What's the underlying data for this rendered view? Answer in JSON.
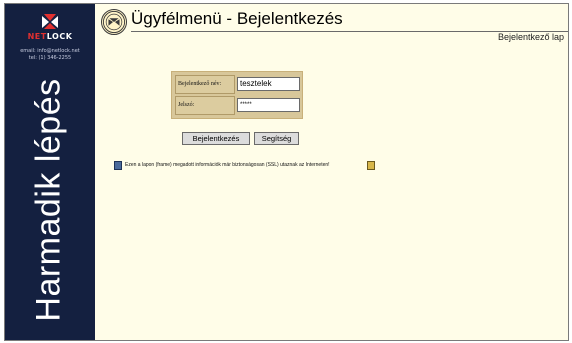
{
  "sidebar": {
    "logo": "NETLOCK",
    "logo_parts": [
      "NET",
      "LOCK"
    ],
    "contact": {
      "email": "email: info@netlock.net",
      "phone": "tel: (1) 346-2255"
    },
    "vertical_title": "Harmadik lépés"
  },
  "header": {
    "title": "Ügyfélmenü - Bejelentkezés",
    "subtitle": "Bejelentkező lap"
  },
  "login": {
    "username_label": "Bejelentkező név:",
    "username_value": "tesztelek",
    "password_label": "Jelszó:",
    "password_value": "*****",
    "login_button": "Bejelentkezés",
    "help_button": "Segítség"
  },
  "notice": {
    "text": "Ezen a lapon (frame) megadott információk már biztonságosan (SSL) utaznak az Interneten!"
  },
  "colors": {
    "sidebar_bg": "#142040",
    "page_bg": "#fffde8",
    "login_box_bg": "#d8c79a",
    "logo_accent": "#e03030"
  },
  "icons": [
    "netlock-logo-icon",
    "seal-icon",
    "lock-icon",
    "key-icon"
  ]
}
